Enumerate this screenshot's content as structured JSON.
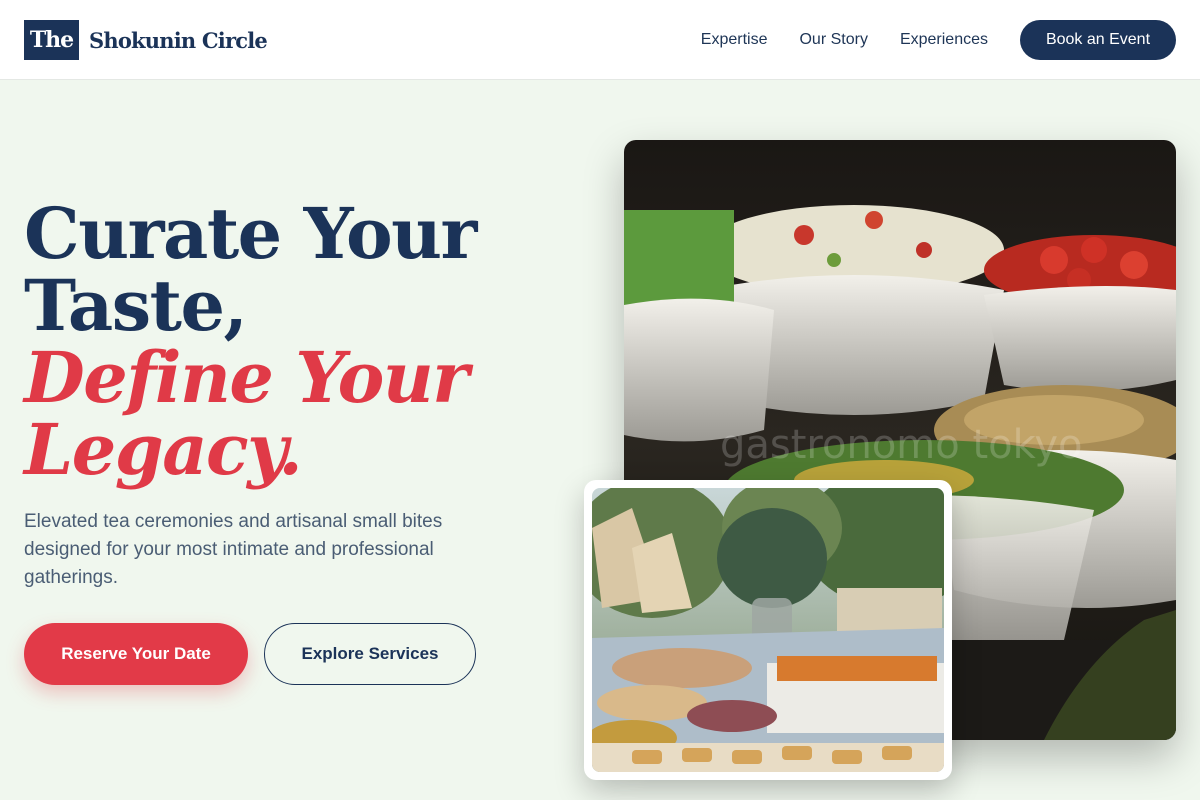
{
  "brand": {
    "mark": "The",
    "name": "Shokunin Circle"
  },
  "nav": {
    "links": [
      "Expertise",
      "Our Story",
      "Experiences"
    ],
    "cta": "Book an Event"
  },
  "hero": {
    "headline_line1": "Curate Your",
    "headline_line2": "Taste,",
    "headline_accent1": "Define Your",
    "headline_accent2": "Legacy.",
    "lead": "Elevated tea ceremonies and artisanal small bites designed for your most intimate and professional gatherings.",
    "primary_cta": "Reserve Your Date",
    "secondary_cta": "Explore Services"
  },
  "images": {
    "main_alt": "Bowls of fresh salads and cherry tomatoes on a buffet table",
    "main_watermark": "gastronomo tokyo",
    "secondary_alt": "Outdoor catering table with small bites in paper boats"
  },
  "colors": {
    "navy": "#1b3358",
    "accent": "#e23a48",
    "background": "#f0f7ee"
  }
}
